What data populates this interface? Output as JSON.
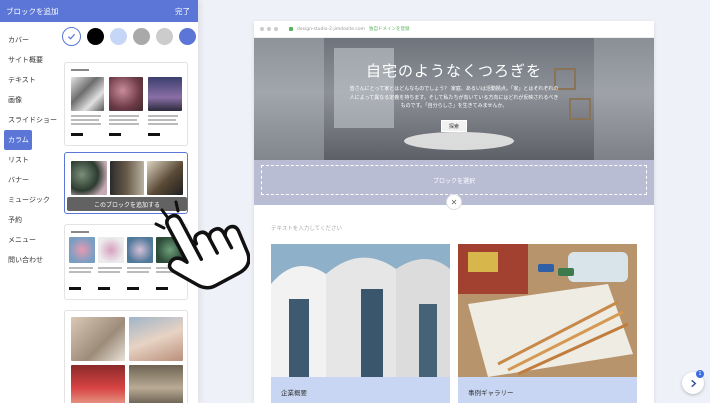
{
  "panel": {
    "title": "ブロックを追加",
    "done": "完了",
    "colors": [
      "#ffffff",
      "#000000",
      "#c6d6f7",
      "#a9a9a9",
      "#cccccc",
      "#5b76d6"
    ],
    "categories": [
      {
        "label": "カバー",
        "active": false
      },
      {
        "label": "サイト概要",
        "active": false
      },
      {
        "label": "テキスト",
        "active": false
      },
      {
        "label": "画像",
        "active": false
      },
      {
        "label": "スライドショー",
        "active": false
      },
      {
        "label": "カラム",
        "active": true
      },
      {
        "label": "リスト",
        "active": false
      },
      {
        "label": "バナー",
        "active": false
      },
      {
        "label": "ミュージック",
        "active": false
      },
      {
        "label": "予約",
        "active": false
      },
      {
        "label": "メニュー",
        "active": false
      },
      {
        "label": "問い合わせ",
        "active": false
      }
    ],
    "add_block_label": "このブロックを追加する"
  },
  "browser": {
    "url_domain": "design-studio-2.jimdosite.com",
    "url_note": "独自ドメインを登録"
  },
  "hero": {
    "title": "自宅のようなくつろぎを",
    "body": "皆さんにとって家とはどんなものでしょう？ 家庭、あるいは活動拠点。「家」とはそれぞれの人によって異なる定義を持ちます。そして私たちが向いている方向にはどれが反映されるべきものです。「自分らしさ」を生きてみませんか。",
    "button": "探索"
  },
  "select_block": "ブロックを選択",
  "text_placeholder": "テキストを入力してください",
  "cards": [
    {
      "label": "企業概要"
    },
    {
      "label": "事例ギャラリー"
    }
  ],
  "accent": "#5b76d6",
  "fab_badge": "1"
}
